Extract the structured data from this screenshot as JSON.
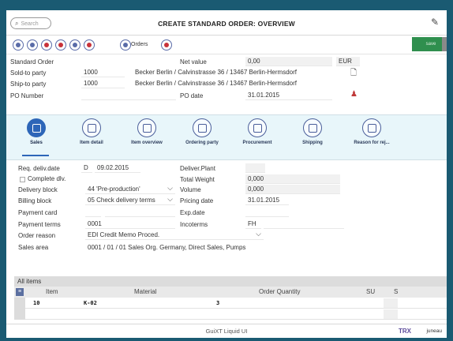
{
  "titlebar": {
    "search_placeholder": "Search",
    "title": "CREATE STANDARD ORDER: OVERVIEW"
  },
  "toolbar": {
    "orders_label": "Orders",
    "save_label": "save"
  },
  "header": {
    "standard_order_label": "Standard Order",
    "sold_to_label": "Sold-to party",
    "sold_to_value": "1000",
    "sold_to_desc": "Becker Berlin / Calvinstrasse 36 / 13467 Berlin-Hermsdorf",
    "ship_to_label": "Ship-to party",
    "ship_to_value": "1000",
    "ship_to_desc": "Becker Berlin / Calvinstrasse 36 / 13467 Berlin-Hermsdorf",
    "po_number_label": "PO Number",
    "net_value_label": "Net value",
    "net_value": "0,00",
    "currency": "EUR",
    "po_date_label": "PO date",
    "po_date": "31.01.2015"
  },
  "tabs": [
    {
      "label": "Sales",
      "icon": "sales-icon"
    },
    {
      "label": "Item detail",
      "icon": "item-detail-icon"
    },
    {
      "label": "Item overview",
      "icon": "item-overview-icon"
    },
    {
      "label": "Ordering party",
      "icon": "ordering-party-icon"
    },
    {
      "label": "Procurement",
      "icon": "procurement-icon"
    },
    {
      "label": "Shipping",
      "icon": "shipping-icon"
    },
    {
      "label": "Reason for rej...",
      "icon": "reason-for-rejection-icon"
    }
  ],
  "sales": {
    "req_deliv_date_label": "Req. deliv.date",
    "req_deliv_date_type": "D",
    "req_deliv_date": "09.02.2015",
    "complete_dlv_label": "Complete dlv.",
    "delivery_block_label": "Delivery block",
    "delivery_block": "44 'Pre-production'",
    "billing_block_label": "Billing block",
    "billing_block": "05 Check delivery terms",
    "payment_card_label": "Payment card",
    "payment_terms_label": "Payment terms",
    "payment_terms": "0001",
    "order_reason_label": "Order reason",
    "order_reason": "EDI Credit Memo Proced.",
    "sales_area_label": "Sales area",
    "sales_area": "0001  /  01  /  01   Sales Org. Germany, Direct Sales, Pumps",
    "deliver_plant_label": "Deliver.Plant",
    "total_weight_label": "Total Weight",
    "total_weight": "0,000",
    "volume_label": "Volume",
    "volume": "0,000",
    "pricing_date_label": "Pricing date",
    "pricing_date": "31.01.2015",
    "exp_date_label": "Exp.date",
    "incoterms_label": "Incoterms",
    "incoterms": "FH"
  },
  "items": {
    "heading": "All items",
    "columns": [
      "Item",
      "Material",
      "Order Quantity",
      "SU",
      "S"
    ],
    "rows": [
      {
        "item": "10",
        "material": "K-02",
        "quantity": "3"
      }
    ]
  },
  "footer": {
    "title": "GuiXT Liquid UI",
    "brand": "TRX",
    "user": "juneau"
  }
}
